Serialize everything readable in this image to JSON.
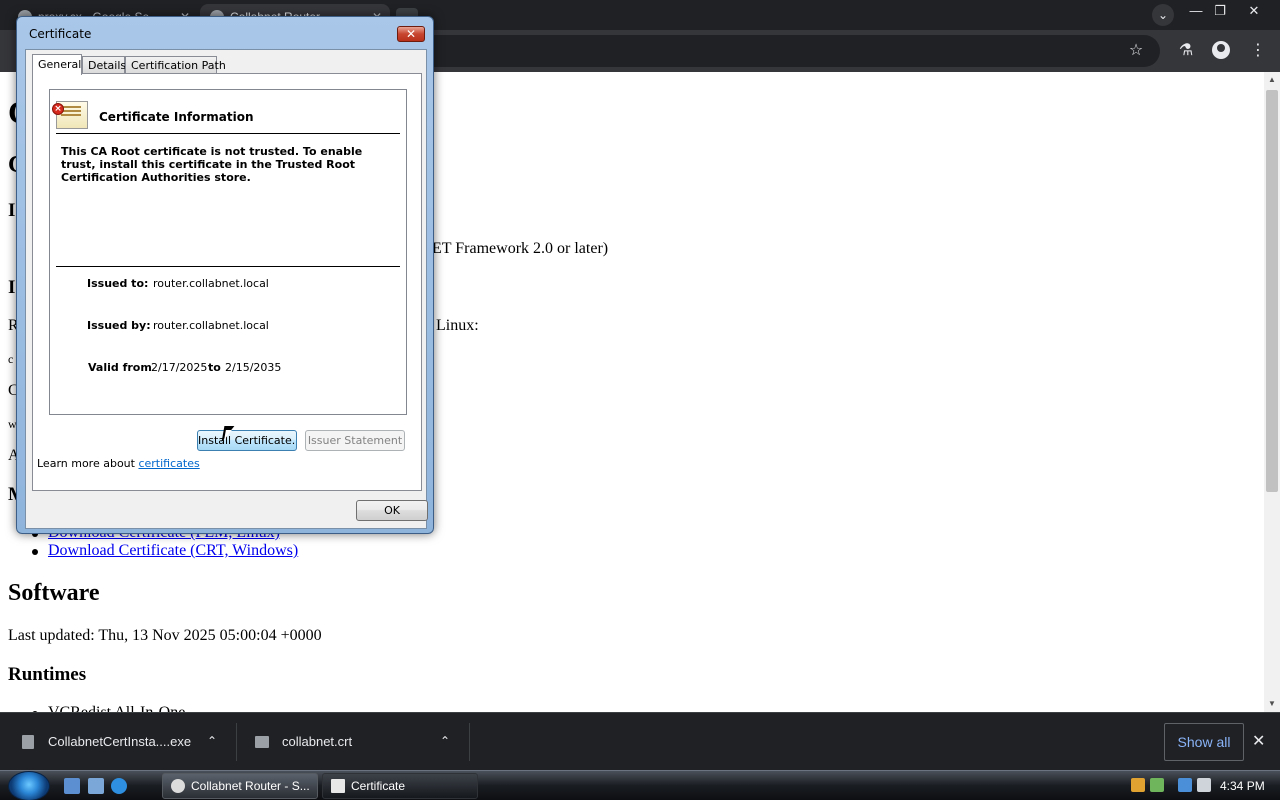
{
  "browser": {
    "tabs": [
      {
        "label": "proxy.cx - Google Se..."
      },
      {
        "label": "Collabnet Router"
      }
    ],
    "window": {
      "minimize": "—",
      "restore": "❐",
      "close": "✕"
    },
    "toolbar": {
      "bookmark_icon": "☆",
      "labs_icon": "⚗",
      "menu_icon": "⋮"
    }
  },
  "page": {
    "heading_1": "C",
    "heading_2": "C",
    "heading_3": "I",
    "framework_text": "ET Framework 2.0 or later)",
    "heading_4": "I",
    "linux_lead": "R",
    "linux_text": "Linux:",
    "small_1": "c",
    "line_c": "C",
    "small_2": "w",
    "line_a": "A",
    "heading_m": "M",
    "links": [
      "Download Certificate (PEM, Linux)",
      "Download Certificate (CRT, Windows)"
    ],
    "software_title": "Software",
    "last_updated": "Last updated: Thu, 13 Nov 2025 05:00:04 +0000",
    "runtimes_title": "Runtimes",
    "runtime_item": "VCRedist All-In-One"
  },
  "downloads": {
    "items": [
      {
        "name": "CollabnetCertInsta....exe"
      },
      {
        "name": "collabnet.crt"
      }
    ],
    "show_all": "Show all",
    "close": "✕"
  },
  "taskbar": {
    "tasks": [
      {
        "label": "Collabnet Router - S..."
      },
      {
        "label": "Certificate"
      }
    ],
    "clock": "4:34 PM"
  },
  "dialog": {
    "title": "Certificate",
    "close": "✕",
    "tabs": [
      "General",
      "Details",
      "Certification Path"
    ],
    "info_title": "Certificate Information",
    "message": "This CA Root certificate is not trusted. To enable trust, install this certificate in the Trusted Root Certification Authorities store.",
    "issued_to_label": "Issued to:",
    "issued_to_value": "router.collabnet.local",
    "issued_by_label": "Issued by:",
    "issued_by_value": "router.collabnet.local",
    "valid_from_label": "Valid from",
    "valid_from_value": "2/17/2025",
    "to_label": "to",
    "valid_to_value": "2/15/2035",
    "install_button": "Install Certificate...",
    "issuer_button": "Issuer Statement",
    "learn_prefix": "Learn more about ",
    "learn_link": "certificates",
    "ok_button": "OK"
  }
}
